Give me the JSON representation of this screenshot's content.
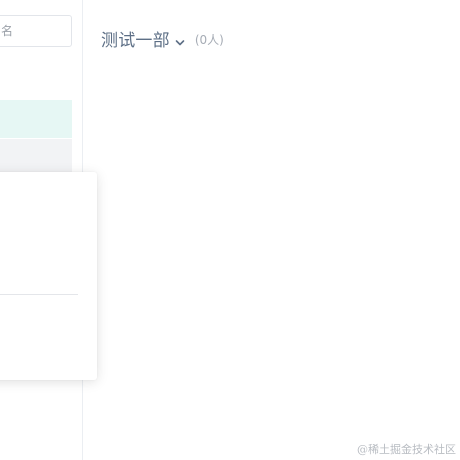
{
  "sidebar": {
    "search_placeholder": "名"
  },
  "header": {
    "department_title": "测试一部",
    "member_count": "(0人)"
  },
  "watermark": "@稀土掘金技术社区",
  "colors": {
    "active_row": "#e6f7f4",
    "hover_row": "#f2f3f5",
    "title_text": "#5d6f86",
    "muted_text": "#a6acb5"
  },
  "icons": {
    "dropdown": "chevron-down-icon"
  }
}
